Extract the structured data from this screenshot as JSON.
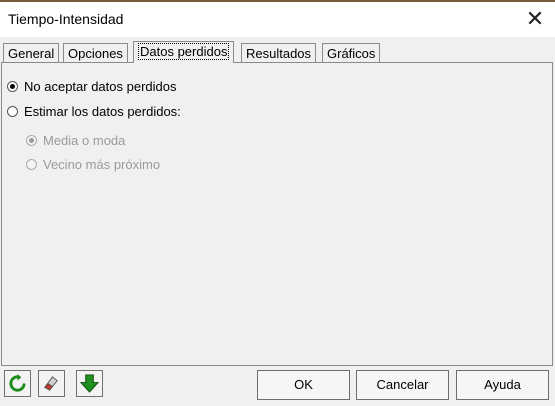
{
  "window": {
    "title": "Tiempo-Intensidad",
    "close_icon": "close-icon"
  },
  "tabs": [
    {
      "label": "General"
    },
    {
      "label": "Opciones"
    },
    {
      "label": "Datos perdidos",
      "active": true
    },
    {
      "label": "Resultados"
    },
    {
      "label": "Gráficos"
    }
  ],
  "options": {
    "no_accept": {
      "label": "No aceptar datos perdidos",
      "checked": true
    },
    "estimate": {
      "label": "Estimar los datos perdidos:",
      "checked": false
    },
    "mean_mode": {
      "label": "Media o moda",
      "checked": true,
      "enabled": false
    },
    "nearest": {
      "label": "Vecino más próximo",
      "checked": false,
      "enabled": false
    }
  },
  "toolbar": {
    "icons": [
      "refresh-icon",
      "eraser-icon",
      "down-arrow-icon"
    ],
    "ok_label": "OK",
    "cancel_label": "Cancelar",
    "help_label": "Ayuda"
  },
  "colors": {
    "refresh": "#1a8a1a",
    "arrow": "#1f8f1f",
    "eraser": "#c0392b"
  }
}
